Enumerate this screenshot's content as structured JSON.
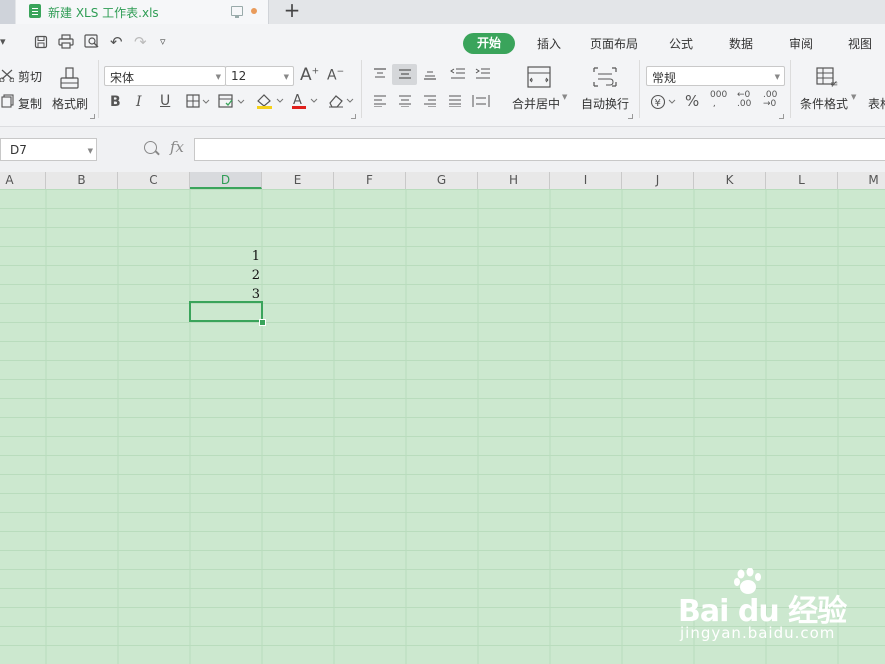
{
  "titlebar": {
    "file_name": "新建 XLS 工作表.xls",
    "new_tab": "+"
  },
  "quick_access": {
    "menu_chevron": "▾",
    "print_icon": "🖶",
    "undo_icon": "↶",
    "redo_icon": "↷",
    "more_icon": "▿"
  },
  "menu_tabs": {
    "home": "开始",
    "insert": "插入",
    "page_layout": "页面布局",
    "formulas": "公式",
    "data": "数据",
    "review": "审阅",
    "view": "视图"
  },
  "ribbon": {
    "cut": "剪切",
    "copy": "复制",
    "format_painter": "格式刷",
    "font_name": "宋体",
    "font_size": "12",
    "merge_center": "合并居中",
    "wrap_text": "自动换行",
    "number_format": "常规",
    "cond_format": "条件格式",
    "table_style": "表格"
  },
  "formula_bar": {
    "namebox": "D7",
    "fx": "fx",
    "formula": ""
  },
  "columns": [
    "A",
    "B",
    "C",
    "D",
    "E",
    "F",
    "G",
    "H",
    "I",
    "J",
    "K",
    "L",
    "M"
  ],
  "active_column": "D",
  "cells": {
    "D4": "1",
    "D5": "2",
    "D6": "3"
  },
  "watermark": {
    "brand": "Bai du 经验",
    "url": "jingyan.baidu.com"
  },
  "colors": {
    "accent": "#3aa45b",
    "sheet_bg": "#cce8cf",
    "gridline": "#b9dcbd"
  }
}
